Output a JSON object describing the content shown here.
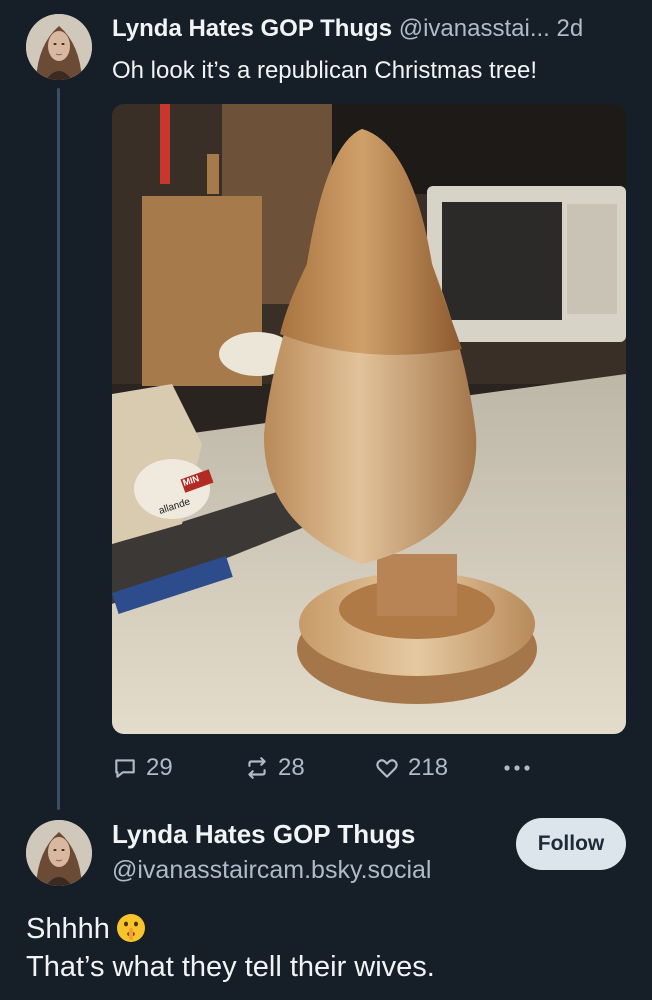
{
  "post": {
    "author": {
      "display_name": "Lynda Hates GOP Thugs",
      "handle": "@ivanasstai...",
      "separator": " ",
      "time": "2d"
    },
    "text": "Oh look it’s a republican Christmas tree!",
    "image": {
      "label_fragment_1": "MIN",
      "label_fragment_2": "allande"
    },
    "stats": {
      "replies": "29",
      "reposts": "28",
      "likes": "218"
    },
    "icons": {
      "reply": "reply-bubble-icon",
      "repost": "repost-arrows-icon",
      "like": "heart-icon",
      "more": "more-dots-icon"
    }
  },
  "profile_card": {
    "display_name": "Lynda Hates GOP Thugs",
    "handle": "@ivanasstaircam.bsky.social",
    "follow_label": "Follow"
  },
  "reply_text": {
    "line1": "Shhhh",
    "emoji": "shushing-face-emoji",
    "line2": "That’s what they tell their wives."
  },
  "colors": {
    "background": "#161e27",
    "thread_line": "#3b4e63",
    "muted_text": "#aebbc9",
    "button_bg": "#dce4ec"
  }
}
